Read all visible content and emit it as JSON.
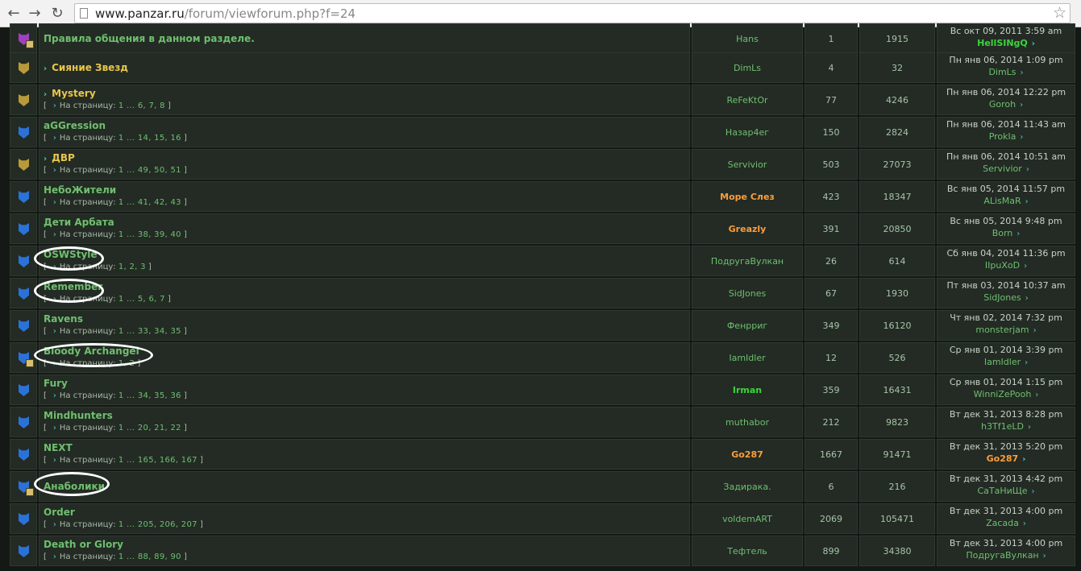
{
  "browser": {
    "back_icon": "back-arrow-icon",
    "forward_icon": "forward-arrow-icon",
    "reload_icon": "reload-icon",
    "url_domain": "www.panzar.ru",
    "url_path": "/forum/viewforum.php?f=24",
    "star_icon": "star-icon"
  },
  "pagination_prefix": "На страницу:",
  "topics": [
    {
      "icon": "purple-locked-shield-icon",
      "title": "Правила общения в данном разделе.",
      "sticky": false,
      "arrow": false,
      "pages": "",
      "author": "Hans",
      "author_style": "normal",
      "replies": "1",
      "views": "1915",
      "last_date": "Вс окт 09, 2011 3:59 am",
      "last_user": "HellSINgQ",
      "last_user_style": "green",
      "circled": false
    },
    {
      "icon": "gold-shield-icon",
      "title": "Сияние Звезд",
      "sticky": true,
      "arrow": true,
      "pages": "",
      "author": "DimLs",
      "author_style": "normal",
      "replies": "4",
      "views": "32",
      "last_date": "Пн янв 06, 2014 1:09 pm",
      "last_user": "DimLs",
      "last_user_style": "normal",
      "circled": false
    },
    {
      "icon": "gold-shield-icon",
      "title": "Mystery",
      "sticky": true,
      "arrow": true,
      "pages": "1 ... 6, 7, 8",
      "author": "ReFeKtOr",
      "author_style": "normal",
      "replies": "77",
      "views": "4246",
      "last_date": "Пн янв 06, 2014 12:22 pm",
      "last_user": "Goroh",
      "last_user_style": "normal",
      "circled": false
    },
    {
      "icon": "blue-shield-icon",
      "title": "aGGression",
      "sticky": false,
      "arrow": false,
      "pages": "1 ... 14, 15, 16",
      "author": "Назар4ег",
      "author_style": "normal",
      "replies": "150",
      "views": "2824",
      "last_date": "Пн янв 06, 2014 11:43 am",
      "last_user": "Prokla",
      "last_user_style": "normal",
      "circled": false
    },
    {
      "icon": "gold-shield-icon",
      "title": "ДВР",
      "sticky": true,
      "arrow": true,
      "pages": "1 ... 49, 50, 51",
      "author": "Servivior",
      "author_style": "normal",
      "replies": "503",
      "views": "27073",
      "last_date": "Пн янв 06, 2014 10:51 am",
      "last_user": "Servivior",
      "last_user_style": "normal",
      "circled": false
    },
    {
      "icon": "blue-shield-icon",
      "title": "НебоЖители",
      "sticky": false,
      "arrow": false,
      "pages": "1 ... 41, 42, 43",
      "author": "Море Слез",
      "author_style": "orange",
      "replies": "423",
      "views": "18347",
      "last_date": "Вс янв 05, 2014 11:57 pm",
      "last_user": "ALisMaR",
      "last_user_style": "normal",
      "circled": false
    },
    {
      "icon": "blue-shield-icon",
      "title": "Дети Арбата",
      "sticky": false,
      "arrow": false,
      "pages": "1 ... 38, 39, 40",
      "author": "Greazly",
      "author_style": "orange",
      "replies": "391",
      "views": "20850",
      "last_date": "Вс янв 05, 2014 9:48 pm",
      "last_user": "Born",
      "last_user_style": "normal",
      "circled": false
    },
    {
      "icon": "blue-shield-icon",
      "title": "OSWStyle",
      "sticky": false,
      "arrow": false,
      "pages": "1, 2, 3",
      "author": "ПодругаВулкан",
      "author_style": "normal",
      "replies": "26",
      "views": "614",
      "last_date": "Сб янв 04, 2014 11:36 pm",
      "last_user": "IIpuXoD",
      "last_user_style": "normal",
      "circled": true
    },
    {
      "icon": "blue-shield-icon",
      "title": "Remember",
      "sticky": false,
      "arrow": false,
      "pages": "1 ... 5, 6, 7",
      "author": "SidJones",
      "author_style": "normal",
      "replies": "67",
      "views": "1930",
      "last_date": "Пт янв 03, 2014 10:37 am",
      "last_user": "SidJones",
      "last_user_style": "normal",
      "circled": true
    },
    {
      "icon": "blue-shield-icon",
      "title": "Ravens",
      "sticky": false,
      "arrow": false,
      "pages": "1 ... 33, 34, 35",
      "author": "Фенрриг",
      "author_style": "normal",
      "replies": "349",
      "views": "16120",
      "last_date": "Чт янв 02, 2014 7:32 pm",
      "last_user": "monsterjam",
      "last_user_style": "normal",
      "circled": false
    },
    {
      "icon": "blue-locked-shield-icon",
      "title": "Bloody Archangel",
      "sticky": false,
      "arrow": false,
      "pages": "1, 2",
      "author": "IamIdler",
      "author_style": "normal",
      "replies": "12",
      "views": "526",
      "last_date": "Ср янв 01, 2014 3:39 pm",
      "last_user": "IamIdler",
      "last_user_style": "normal",
      "circled": true
    },
    {
      "icon": "blue-shield-icon",
      "title": "Fury",
      "sticky": false,
      "arrow": false,
      "pages": "1 ... 34, 35, 36",
      "author": "Irman",
      "author_style": "green",
      "replies": "359",
      "views": "16431",
      "last_date": "Ср янв 01, 2014 1:15 pm",
      "last_user": "WinniZePooh",
      "last_user_style": "normal",
      "circled": false
    },
    {
      "icon": "blue-shield-icon",
      "title": "Mindhunters",
      "sticky": false,
      "arrow": false,
      "pages": "1 ... 20, 21, 22",
      "author": "muthabor",
      "author_style": "normal",
      "replies": "212",
      "views": "9823",
      "last_date": "Вт дек 31, 2013 8:28 pm",
      "last_user": "h3Tf1eLD",
      "last_user_style": "normal",
      "circled": false
    },
    {
      "icon": "blue-shield-icon",
      "title": "NEXT",
      "sticky": false,
      "arrow": false,
      "pages": "1 ... 165, 166, 167",
      "author": "Go287",
      "author_style": "orange",
      "replies": "1667",
      "views": "91471",
      "last_date": "Вт дек 31, 2013 5:20 pm",
      "last_user": "Go287",
      "last_user_style": "orange",
      "circled": false
    },
    {
      "icon": "blue-locked-shield-icon",
      "title": "Анаболики",
      "sticky": false,
      "arrow": false,
      "pages": "",
      "author": "Задирака.",
      "author_style": "normal",
      "replies": "6",
      "views": "216",
      "last_date": "Вт дек 31, 2013 4:42 pm",
      "last_user": "СаТаНиЩе",
      "last_user_style": "normal",
      "circled": true
    },
    {
      "icon": "blue-shield-icon",
      "title": "Order",
      "sticky": false,
      "arrow": false,
      "pages": "1 ... 205, 206, 207",
      "author": "voldemART",
      "author_style": "normal",
      "replies": "2069",
      "views": "105471",
      "last_date": "Вт дек 31, 2013 4:00 pm",
      "last_user": "Zacada",
      "last_user_style": "normal",
      "circled": false
    },
    {
      "icon": "blue-shield-icon",
      "title": "Death or Glory",
      "sticky": false,
      "arrow": false,
      "pages": "1 ... 88, 89, 90",
      "author": "Тефтель",
      "author_style": "normal",
      "replies": "899",
      "views": "34380",
      "last_date": "Вт дек 31, 2013 4:00 pm",
      "last_user": "ПодругаВулкан",
      "last_user_style": "normal",
      "circled": false
    }
  ]
}
